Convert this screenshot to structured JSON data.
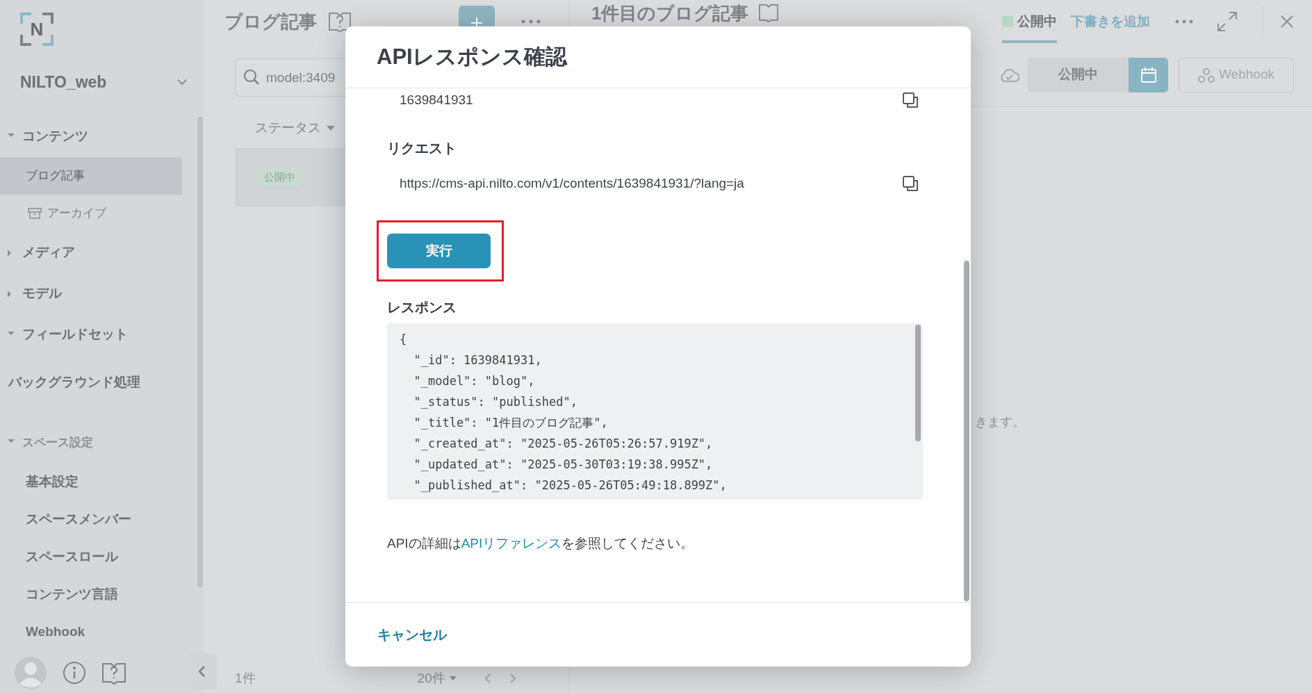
{
  "sidebar": {
    "logo_text": "N",
    "workspace": "NILTO_web",
    "nav": [
      {
        "label": "コンテンツ",
        "kind": "group",
        "expanded": true,
        "children": [
          {
            "label": "ブログ記事",
            "selected": true
          },
          {
            "label": "アーカイブ",
            "kind": "archive",
            "selected": false
          }
        ]
      },
      {
        "label": "メディア",
        "kind": "group",
        "expanded": false
      },
      {
        "label": "モデル",
        "kind": "group",
        "expanded": false
      },
      {
        "label": "フィールドセット",
        "kind": "group",
        "expanded": true
      },
      {
        "label": "バックグラウンド処理",
        "kind": "link"
      },
      {
        "label": "スペース設定",
        "kind": "settings",
        "expanded": true,
        "children": [
          {
            "label": "基本設定",
            "selected": false
          },
          {
            "label": "スペースメンバー",
            "selected": false
          },
          {
            "label": "スペースロール",
            "selected": false
          },
          {
            "label": "コンテンツ言語",
            "selected": false
          },
          {
            "label": "Webhook",
            "selected": false
          }
        ]
      }
    ]
  },
  "list_panel": {
    "title": "ブログ記事",
    "search": {
      "value": "model:3409"
    },
    "filter": "ステータス",
    "rows": [
      {
        "status": "公開中"
      }
    ],
    "count": "1件",
    "per_page": "20件"
  },
  "detail": {
    "title": "1件目のブログ記事",
    "status_tab": {
      "label": "公開中",
      "selected": true
    },
    "add_draft": "下書きを追加",
    "status_button": "公開中",
    "webhook_button": "Webhook",
    "message": "きます。"
  },
  "modal": {
    "title": "APIレスポンス確認",
    "id_value": "1639841931",
    "request_label": "リクエスト",
    "request_url": "https://cms-api.nilto.com/v1/contents/1639841931/?lang=ja",
    "run_button": "実行",
    "response_label": "レスポンス",
    "response_lines": [
      "{",
      "  \"_id\": 1639841931,",
      "  \"_model\": \"blog\",",
      "  \"_status\": \"published\",",
      "  \"_title\": \"1件目のブログ記事\",",
      "  \"_created_at\": \"2025-05-26T05:26:57.919Z\",",
      "  \"_updated_at\": \"2025-05-30T03:19:38.995Z\",",
      "  \"_published_at\": \"2025-05-26T05:49:18.899Z\","
    ],
    "note_before": "APIの詳細は",
    "note_link": "APIリファレンス",
    "note_after": "を参照してください。",
    "cancel": "キャンセル"
  }
}
